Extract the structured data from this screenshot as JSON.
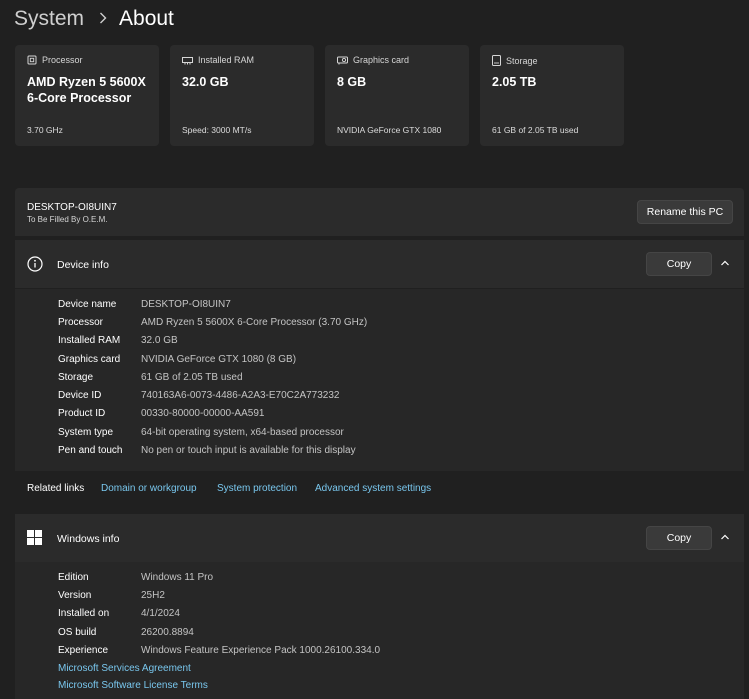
{
  "breadcrumb": {
    "parent": "System",
    "current": "About"
  },
  "cards": [
    {
      "icon": "processor-icon",
      "label": "Processor",
      "value": "AMD Ryzen 5 5600X 6-Core Processor",
      "sub": "3.70 GHz"
    },
    {
      "icon": "ram-icon",
      "label": "Installed RAM",
      "value": "32.0 GB",
      "sub": "Speed: 3000 MT/s"
    },
    {
      "icon": "graphics-card-icon",
      "label": "Graphics card",
      "value": "8 GB",
      "sub": "NVIDIA GeForce GTX 1080"
    },
    {
      "icon": "storage-icon",
      "label": "Storage",
      "value": "2.05 TB",
      "sub": "61 GB of 2.05 TB used"
    }
  ],
  "pc": {
    "name": "DESKTOP-OI8UIN7",
    "model": "To Be Filled By O.E.M.",
    "rename_label": "Rename this PC"
  },
  "device_info": {
    "title": "Device info",
    "copy_label": "Copy",
    "rows": [
      {
        "label": "Device name",
        "value": "DESKTOP-OI8UIN7"
      },
      {
        "label": "Processor",
        "value": "AMD Ryzen 5 5600X 6-Core Processor (3.70 GHz)"
      },
      {
        "label": "Installed RAM",
        "value": "32.0 GB"
      },
      {
        "label": "Graphics card",
        "value": "NVIDIA GeForce GTX 1080 (8 GB)"
      },
      {
        "label": "Storage",
        "value": "61 GB of 2.05 TB used"
      },
      {
        "label": "Device ID",
        "value": "740163A6-0073-4486-A2A3-E70C2A773232"
      },
      {
        "label": "Product ID",
        "value": "00330-80000-00000-AA591"
      },
      {
        "label": "System type",
        "value": "64-bit operating system, x64-based processor"
      },
      {
        "label": "Pen and touch",
        "value": "No pen or touch input is available for this display"
      }
    ]
  },
  "related_links": {
    "title": "Related links",
    "links": [
      "Domain or workgroup",
      "System protection",
      "Advanced system settings"
    ]
  },
  "windows_info": {
    "title": "Windows info",
    "copy_label": "Copy",
    "rows": [
      {
        "label": "Edition",
        "value": "Windows 11 Pro"
      },
      {
        "label": "Version",
        "value": "25H2"
      },
      {
        "label": "Installed on",
        "value": "4/1/2024"
      },
      {
        "label": "OS build",
        "value": "26200.8894"
      },
      {
        "label": "Experience",
        "value": "Windows Feature Experience Pack 1000.26100.334.0"
      }
    ],
    "links": [
      "Microsoft Services Agreement",
      "Microsoft Software License Terms"
    ]
  },
  "colors": {
    "background": "#202020",
    "card": "#2b2b2b",
    "link": "#79c7ee"
  }
}
